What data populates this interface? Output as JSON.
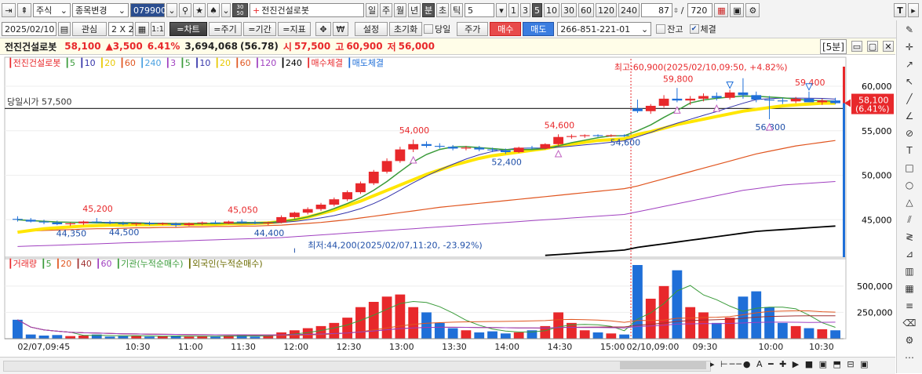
{
  "toolbar1": {
    "market": "주식",
    "change_label": "종목변경",
    "code": "079900",
    "stock_name": "전진건설로봇",
    "periods": [
      "일",
      "주",
      "월",
      "년",
      "분",
      "초",
      "틱"
    ],
    "interval": "5",
    "interval_buttons": [
      "1",
      "3",
      "5",
      "10",
      "30",
      "60",
      "120",
      "240"
    ],
    "count": "87",
    "total": "720",
    "sep": "/",
    "t_label": "T"
  },
  "toolbar2": {
    "date": "2025/02/10",
    "interest": "관심",
    "layout": "2 X 2",
    "oneone": "1:1",
    "chart_btn": "=차트",
    "period_btn": "=주기",
    "range_btn": "=기간",
    "indicator_btn": "=지표",
    "settings": "설정",
    "reset": "초기화",
    "today": "당일",
    "price_btn": "주가",
    "buy_btn": "매수",
    "sell_btn": "매도",
    "account": "266-851-221-01",
    "balance": "잔고",
    "filled": "체결"
  },
  "info": {
    "name": "전진건설로봇",
    "price": "58,100",
    "change": "▲3,500",
    "pct": "6.41%",
    "volume": "3,694,068",
    "vol_ratio": "(56.78)",
    "open_label": "시",
    "open": "57,500",
    "high_label": "고",
    "high": "60,900",
    "low_label": "저",
    "low": "56,000",
    "interval_tag": "[5분]"
  },
  "colors": {
    "up": "#e8282b",
    "down": "#1f6fd8",
    "ma5": "#3a9b3a",
    "ma10": "#3333aa",
    "ma20": "#ffe600",
    "ma60": "#e0551f",
    "ma240": "#a040c0",
    "ma_black": "#000000"
  },
  "price_legend": [
    {
      "text": "전진건설로봇",
      "color": "#e8282b"
    },
    {
      "text": "5",
      "color": "#3a9b3a"
    },
    {
      "text": "10",
      "color": "#3333aa"
    },
    {
      "text": "20",
      "color": "#e8c800"
    },
    {
      "text": "60",
      "color": "#e0551f"
    },
    {
      "text": "240",
      "color": "#4aa0e0"
    },
    {
      "text": "3",
      "color": "#a040c0"
    },
    {
      "text": "5",
      "color": "#3a9b3a"
    },
    {
      "text": "10",
      "color": "#3333aa"
    },
    {
      "text": "20",
      "color": "#e8c800"
    },
    {
      "text": "60",
      "color": "#e0551f"
    },
    {
      "text": "120",
      "color": "#a040c0"
    },
    {
      "text": "240",
      "color": "#000000"
    },
    {
      "text": "매수체결",
      "color": "#e8282b"
    },
    {
      "text": "매도체결",
      "color": "#1f6fd8"
    }
  ],
  "volume_legend": [
    {
      "text": "거래량",
      "color": "#e8282b"
    },
    {
      "text": "5",
      "color": "#3a9b3a"
    },
    {
      "text": "20",
      "color": "#e0551f"
    },
    {
      "text": "40",
      "color": "#a03030"
    },
    {
      "text": "60",
      "color": "#a040c0"
    },
    {
      "text": "기관(누적순매수)",
      "color": "#3a9b3a"
    },
    {
      "text": "외국인(누적순매수)",
      "color": "#6b6b00"
    }
  ],
  "chart_data": {
    "type": "candlestick",
    "x_ticks": [
      "02/07,09:45",
      "10:30",
      "11:00",
      "11:30",
      "12:00",
      "12:30",
      "13:00",
      "13:30",
      "14:00",
      "14:30",
      "15:00",
      "02/10,09:00",
      "09:30",
      "10:00",
      "10:30"
    ],
    "y_ticks": [
      "60,000",
      "55,000",
      "50,000",
      "45,000"
    ],
    "y_range": [
      40800,
      62200
    ],
    "vol_ticks": [
      "500,000",
      "250,000"
    ],
    "vol_range": [
      0,
      700000
    ],
    "open_line_label": "당일시가 57,500",
    "open_line_value": 57500,
    "current_price": "58,100",
    "current_pct": "(6.41%)",
    "current_value": 58100,
    "max_note": "최고:60,900(2025/02/10,09:50, +4.82%)",
    "min_note": "최저:44,200(2025/02/07,11:20, -23.92%)",
    "labels": [
      {
        "text": "45,200",
        "i": 6,
        "v": 45200,
        "color": "#e8282b",
        "dy": -8
      },
      {
        "text": "44,350",
        "i": 4,
        "v": 44350,
        "color": "#1f4fa8",
        "dy": 14
      },
      {
        "text": "44,500",
        "i": 8,
        "v": 44500,
        "color": "#1f4fa8",
        "dy": 14
      },
      {
        "text": "45,050",
        "i": 17,
        "v": 45050,
        "color": "#e8282b",
        "dy": -8
      },
      {
        "text": "44,400",
        "i": 19,
        "v": 44400,
        "color": "#1f4fa8",
        "dy": 14
      },
      {
        "text": "54,000",
        "i": 30,
        "v": 54000,
        "color": "#e8282b",
        "dy": -8
      },
      {
        "text": "52,400",
        "i": 37,
        "v": 52400,
        "color": "#1f4fa8",
        "dy": 14
      },
      {
        "text": "54,600",
        "i": 41,
        "v": 54600,
        "color": "#e8282b",
        "dy": -8
      },
      {
        "text": "54,600",
        "i": 46,
        "v": 54600,
        "color": "#1f4fa8",
        "dy": 14
      },
      {
        "text": "59,800",
        "i": 50,
        "v": 59800,
        "color": "#e8282b",
        "dy": -8
      },
      {
        "text": "59,400",
        "i": 60,
        "v": 59400,
        "color": "#e8282b",
        "dy": -8
      },
      {
        "text": "56,300",
        "i": 57,
        "v": 56300,
        "color": "#1f4fa8",
        "dy": 14
      }
    ],
    "candles": [
      [
        45100,
        45400,
        44800,
        45000
      ],
      [
        45000,
        45200,
        44700,
        44800
      ],
      [
        44800,
        45000,
        44500,
        44700
      ],
      [
        44700,
        44900,
        44400,
        44500
      ],
      [
        44500,
        44700,
        44300,
        44600
      ],
      [
        44600,
        44900,
        44400,
        44800
      ],
      [
        44800,
        45200,
        44600,
        44700
      ],
      [
        44700,
        44900,
        44500,
        44600
      ],
      [
        44600,
        44800,
        44400,
        44500
      ],
      [
        44500,
        44700,
        44300,
        44600
      ],
      [
        44600,
        44800,
        44400,
        44500
      ],
      [
        44500,
        44700,
        44400,
        44600
      ],
      [
        44600,
        44700,
        44200,
        44400
      ],
      [
        44400,
        44700,
        44300,
        44600
      ],
      [
        44600,
        44800,
        44400,
        44700
      ],
      [
        44700,
        44900,
        44500,
        44600
      ],
      [
        44600,
        44900,
        44500,
        44800
      ],
      [
        44800,
        45050,
        44600,
        44700
      ],
      [
        44700,
        44900,
        44500,
        44600
      ],
      [
        44600,
        44800,
        44400,
        44700
      ],
      [
        44700,
        45500,
        44600,
        45300
      ],
      [
        45300,
        45900,
        45100,
        45800
      ],
      [
        45800,
        46400,
        45600,
        46200
      ],
      [
        46200,
        46900,
        46000,
        46700
      ],
      [
        46700,
        47500,
        46500,
        47300
      ],
      [
        47300,
        48300,
        47100,
        48100
      ],
      [
        48100,
        49300,
        47900,
        49100
      ],
      [
        49100,
        50600,
        48900,
        50400
      ],
      [
        50400,
        51900,
        50200,
        51600
      ],
      [
        51600,
        53200,
        51400,
        52900
      ],
      [
        52900,
        54000,
        52600,
        53500
      ],
      [
        53500,
        53800,
        53100,
        53300
      ],
      [
        53300,
        53600,
        53000,
        53200
      ],
      [
        53200,
        53400,
        52800,
        53000
      ],
      [
        53000,
        53300,
        52800,
        53100
      ],
      [
        53100,
        53300,
        52700,
        52900
      ],
      [
        52900,
        53100,
        52600,
        52800
      ],
      [
        52800,
        53000,
        52400,
        52600
      ],
      [
        52600,
        53200,
        52500,
        53100
      ],
      [
        53100,
        53300,
        52900,
        53000
      ],
      [
        53000,
        53600,
        52900,
        53500
      ],
      [
        53500,
        54600,
        53300,
        54300
      ],
      [
        54300,
        54600,
        54100,
        54400
      ],
      [
        54400,
        54600,
        54200,
        54500
      ],
      [
        54500,
        54600,
        54300,
        54400
      ],
      [
        54400,
        54600,
        54300,
        54500
      ],
      [
        54500,
        54600,
        54300,
        54400
      ],
      [
        57500,
        58500,
        57000,
        57200
      ],
      [
        57200,
        58000,
        56900,
        57800
      ],
      [
        57800,
        59000,
        57600,
        58600
      ],
      [
        58600,
        59800,
        58200,
        58400
      ],
      [
        58400,
        58900,
        57900,
        58600
      ],
      [
        58600,
        59200,
        58300,
        58900
      ],
      [
        58900,
        59300,
        58400,
        58700
      ],
      [
        58700,
        59600,
        58500,
        59300
      ],
      [
        59300,
        60900,
        58600,
        59000
      ],
      [
        59000,
        59400,
        58200,
        58500
      ],
      [
        58500,
        58900,
        56300,
        58400
      ],
      [
        58400,
        58700,
        58000,
        58300
      ],
      [
        58300,
        58800,
        58100,
        58600
      ],
      [
        58600,
        59400,
        58300,
        58200
      ],
      [
        58200,
        58600,
        57900,
        58400
      ],
      [
        58400,
        58700,
        58000,
        58100
      ]
    ],
    "volumes": [
      180000,
      40000,
      30000,
      35000,
      25000,
      30000,
      40000,
      20000,
      25000,
      30000,
      20000,
      25000,
      30000,
      20000,
      25000,
      20000,
      30000,
      35000,
      20000,
      30000,
      60000,
      80000,
      100000,
      120000,
      150000,
      200000,
      300000,
      350000,
      400000,
      420000,
      300000,
      250000,
      150000,
      100000,
      80000,
      60000,
      70000,
      50000,
      60000,
      80000,
      120000,
      250000,
      150000,
      80000,
      60000,
      50000,
      40000,
      700000,
      380000,
      500000,
      650000,
      300000,
      250000,
      150000,
      200000,
      400000,
      450000,
      300000,
      150000,
      120000,
      100000,
      90000,
      80000
    ],
    "ma20": [
      43600,
      43800,
      44000,
      44100,
      44200,
      44300,
      44350,
      44400,
      44400,
      44450,
      44450,
      44500,
      44500,
      44500,
      44500,
      44500,
      44550,
      44550,
      44600,
      44650,
      44800,
      45000,
      45300,
      45700,
      46100,
      46600,
      47100,
      47700,
      48300,
      48900,
      49500,
      50100,
      50600,
      51100,
      51500,
      51900,
      52200,
      52400,
      52600,
      52800,
      53000,
      53300,
      53500,
      53700,
      53900,
      54000,
      54100,
      54600,
      54900,
      55300,
      55700,
      56000,
      56300,
      56600,
      56900,
      57200,
      57400,
      57600,
      57800,
      57900,
      58000,
      58100,
      58100
    ],
    "ma60": [
      43700,
      43750,
      43800,
      43850,
      43900,
      43950,
      44000,
      44000,
      44050,
      44100,
      44100,
      44150,
      44150,
      44200,
      44200,
      44250,
      44250,
      44300,
      44300,
      44350,
      44400,
      44500,
      44600,
      44700,
      44850,
      45000,
      45200,
      45400,
      45600,
      45800,
      46000,
      46200,
      46400,
      46550,
      46700,
      46850,
      47000,
      47150,
      47300,
      47450,
      47600,
      47750,
      47900,
      48050,
      48200,
      48350,
      48500,
      48800,
      49200,
      49600,
      50000,
      50400,
      50800,
      51200,
      51600,
      52000,
      52400,
      52700,
      53000,
      53300,
      53500,
      53700,
      53900
    ],
    "ma240": [
      42000,
      42050,
      42100,
      42150,
      42200,
      42250,
      42300,
      42350,
      42400,
      42450,
      42500,
      42550,
      42600,
      42650,
      42700,
      42750,
      42800,
      42850,
      42900,
      42950,
      43000,
      43100,
      43200,
      43300,
      43400,
      43500,
      43600,
      43700,
      43800,
      43900,
      44000,
      44100,
      44200,
      44300,
      44400,
      44500,
      44600,
      44700,
      44800,
      44900,
      45000,
      45100,
      45200,
      45300,
      45400,
      45500,
      45600,
      45900,
      46200,
      46500,
      46800,
      47100,
      47400,
      47700,
      48000,
      48300,
      48500,
      48700,
      48900,
      49000,
      49100,
      49200,
      49300
    ],
    "ma_black": [
      null,
      null,
      null,
      null,
      null,
      null,
      null,
      null,
      null,
      null,
      null,
      null,
      null,
      null,
      null,
      null,
      null,
      null,
      null,
      null,
      null,
      null,
      null,
      null,
      null,
      null,
      null,
      null,
      null,
      null,
      null,
      null,
      null,
      null,
      null,
      null,
      null,
      null,
      null,
      null,
      41000,
      41100,
      41200,
      41300,
      41400,
      41500,
      41600,
      41900,
      42100,
      42300,
      42500,
      42700,
      42900,
      43100,
      43300,
      43500,
      43700,
      43800,
      43900,
      44000,
      44100,
      44200,
      44300
    ]
  }
}
